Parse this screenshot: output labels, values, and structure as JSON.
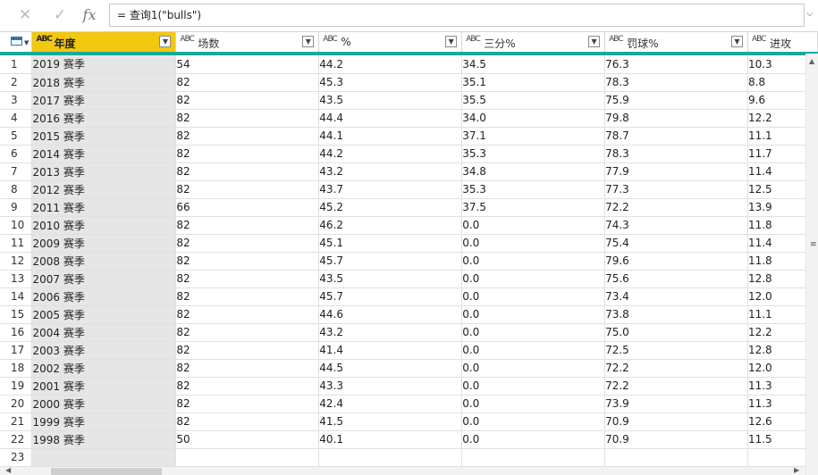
{
  "formula_bar": {
    "cancel_icon": "✕",
    "confirm_icon": "✓",
    "fx_icon": "fx",
    "formula": "= 查询1(\"bulls\")",
    "expand_icon": "⌵"
  },
  "table": {
    "columns": [
      {
        "type": "ABC",
        "label": "年度",
        "active": true
      },
      {
        "type": "ABC",
        "label": "场数"
      },
      {
        "type": "ABC",
        "label": "%"
      },
      {
        "type": "ABC",
        "label": "三分%"
      },
      {
        "type": "ABC",
        "label": "罚球%"
      },
      {
        "type": "ABC",
        "label": "进攻"
      }
    ],
    "rows": [
      [
        "1",
        "2019 赛季",
        "54",
        "44.2",
        "34.5",
        "76.3",
        "10.3"
      ],
      [
        "2",
        "2018 赛季",
        "82",
        "45.3",
        "35.1",
        "78.3",
        "8.8"
      ],
      [
        "3",
        "2017 赛季",
        "82",
        "43.5",
        "35.5",
        "75.9",
        "9.6"
      ],
      [
        "4",
        "2016 赛季",
        "82",
        "44.4",
        "34.0",
        "79.8",
        "12.2"
      ],
      [
        "5",
        "2015 赛季",
        "82",
        "44.1",
        "37.1",
        "78.7",
        "11.1"
      ],
      [
        "6",
        "2014 赛季",
        "82",
        "44.2",
        "35.3",
        "78.3",
        "11.7"
      ],
      [
        "7",
        "2013 赛季",
        "82",
        "43.2",
        "34.8",
        "77.9",
        "11.4"
      ],
      [
        "8",
        "2012 赛季",
        "82",
        "43.7",
        "35.3",
        "77.3",
        "12.5"
      ],
      [
        "9",
        "2011 赛季",
        "66",
        "45.2",
        "37.5",
        "72.2",
        "13.9"
      ],
      [
        "10",
        "2010 赛季",
        "82",
        "46.2",
        "0.0",
        "74.3",
        "11.8"
      ],
      [
        "11",
        "2009 赛季",
        "82",
        "45.1",
        "0.0",
        "75.4",
        "11.4"
      ],
      [
        "12",
        "2008 赛季",
        "82",
        "45.7",
        "0.0",
        "79.6",
        "11.8"
      ],
      [
        "13",
        "2007 赛季",
        "82",
        "43.5",
        "0.0",
        "75.6",
        "12.8"
      ],
      [
        "14",
        "2006 赛季",
        "82",
        "45.7",
        "0.0",
        "73.4",
        "12.0"
      ],
      [
        "15",
        "2005 赛季",
        "82",
        "44.6",
        "0.0",
        "73.8",
        "11.1"
      ],
      [
        "16",
        "2004 赛季",
        "82",
        "43.2",
        "0.0",
        "75.0",
        "12.2"
      ],
      [
        "17",
        "2003 赛季",
        "82",
        "41.4",
        "0.0",
        "72.5",
        "12.8"
      ],
      [
        "18",
        "2002 赛季",
        "82",
        "44.5",
        "0.0",
        "72.2",
        "12.0"
      ],
      [
        "19",
        "2001 赛季",
        "82",
        "43.3",
        "0.0",
        "72.2",
        "11.3"
      ],
      [
        "20",
        "2000 赛季",
        "82",
        "42.4",
        "0.0",
        "73.9",
        "11.3"
      ],
      [
        "21",
        "1999 赛季",
        "82",
        "41.5",
        "0.0",
        "70.9",
        "12.6"
      ],
      [
        "22",
        "1998 赛季",
        "50",
        "40.1",
        "0.0",
        "70.9",
        "11.5"
      ],
      [
        "23",
        "",
        "",
        "",
        "",
        "",
        ""
      ]
    ]
  },
  "colors": {
    "active_header": "#f2c811",
    "accent_line": "#19a99a",
    "year_cell_bg": "#e6e6e6"
  }
}
